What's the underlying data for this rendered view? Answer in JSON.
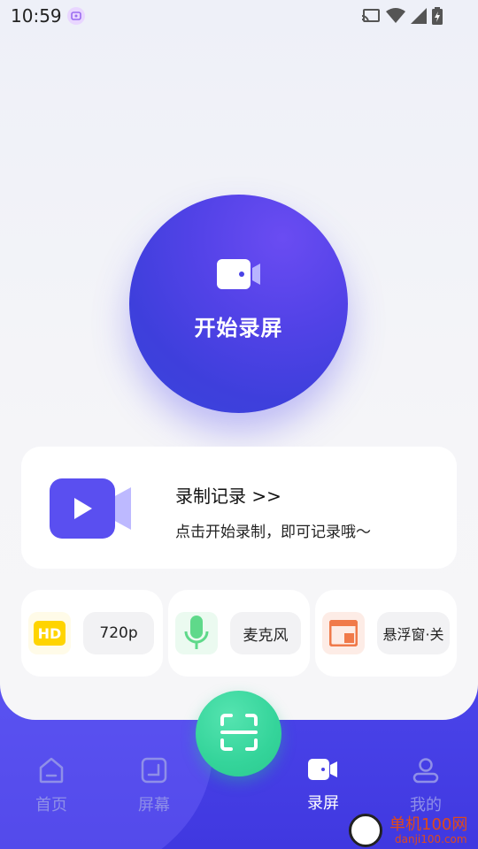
{
  "status_bar": {
    "time": "10:59"
  },
  "record_button": {
    "label": "开始录屏"
  },
  "history": {
    "title": "录制记录 >>",
    "subtitle": "点击开始录制，即可记录哦～"
  },
  "options": [
    {
      "icon": "hd-icon",
      "value": "720p"
    },
    {
      "icon": "microphone-icon",
      "value": "麦克风"
    },
    {
      "icon": "floating-window-icon",
      "value": "悬浮窗·关"
    }
  ],
  "nav": {
    "items": [
      {
        "label": "首页",
        "icon": "home-icon",
        "active": false
      },
      {
        "label": "屏幕",
        "icon": "screen-icon",
        "active": false
      },
      {
        "label": "录屏",
        "icon": "video-camera-icon",
        "active": true
      },
      {
        "label": "我的",
        "icon": "user-icon",
        "active": false
      }
    ]
  },
  "watermark": {
    "line1": "单机100网",
    "line2": "danji100.com"
  },
  "colors": {
    "primary": "#4a43e6",
    "scan_button": "#34d49a",
    "hd_badge": "#ffd400",
    "mic": "#5fd98a",
    "float_window": "#f07a4a"
  }
}
